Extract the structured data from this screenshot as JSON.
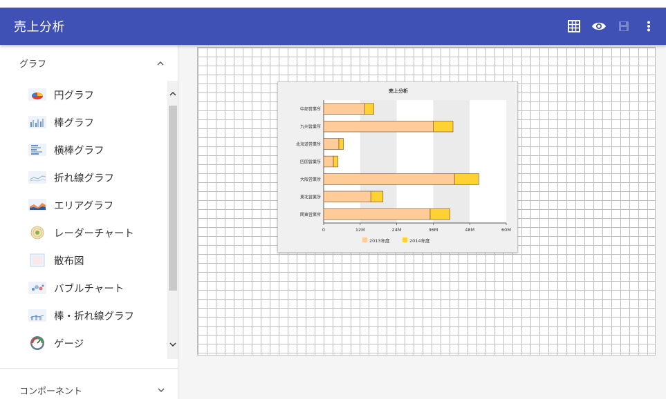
{
  "app": {
    "title": "売上分析"
  },
  "toolbar": {
    "icons": [
      "grid-icon",
      "eye-icon",
      "save-icon",
      "more-vert-icon"
    ]
  },
  "sidebar": {
    "section1": {
      "label": "グラフ"
    },
    "items": [
      {
        "label": "円グラフ",
        "icon": "pie-chart-icon"
      },
      {
        "label": "棒グラフ",
        "icon": "bar-chart-icon"
      },
      {
        "label": "横棒グラフ",
        "icon": "horizontal-bar-chart-icon"
      },
      {
        "label": "折れ線グラフ",
        "icon": "line-chart-icon"
      },
      {
        "label": "エリアグラフ",
        "icon": "area-chart-icon"
      },
      {
        "label": "レーダーチャート",
        "icon": "radar-chart-icon"
      },
      {
        "label": "散布図",
        "icon": "scatter-plot-icon"
      },
      {
        "label": "バブルチャート",
        "icon": "bubble-chart-icon"
      },
      {
        "label": "棒・折れ線グラフ",
        "icon": "bar-line-chart-icon"
      },
      {
        "label": "ゲージ",
        "icon": "gauge-icon"
      }
    ],
    "section2": {
      "label": "コンポーネント"
    }
  },
  "colors": {
    "appbar": "#3f51b5",
    "series2013": "#ffcc99",
    "series2014": "#ffd133"
  },
  "chart_data": {
    "type": "bar",
    "orientation": "horizontal",
    "stacked": true,
    "title": "売上分析",
    "categories": [
      "中部営業所",
      "九州営業所",
      "北海道営業所",
      "四国営業所",
      "大阪営業所",
      "東北営業所",
      "関東営業所"
    ],
    "series": [
      {
        "name": "2013年度",
        "values": [
          13.5,
          36,
          5,
          3.2,
          43,
          15.5,
          35
        ]
      },
      {
        "name": "2014年度",
        "values": [
          3,
          6.5,
          1.5,
          1.5,
          8,
          4,
          6.5
        ]
      }
    ],
    "xticks": [
      "0",
      "12M",
      "24M",
      "36M",
      "48M",
      "60M"
    ],
    "xlim": [
      0,
      60
    ],
    "legend": "bottom"
  }
}
